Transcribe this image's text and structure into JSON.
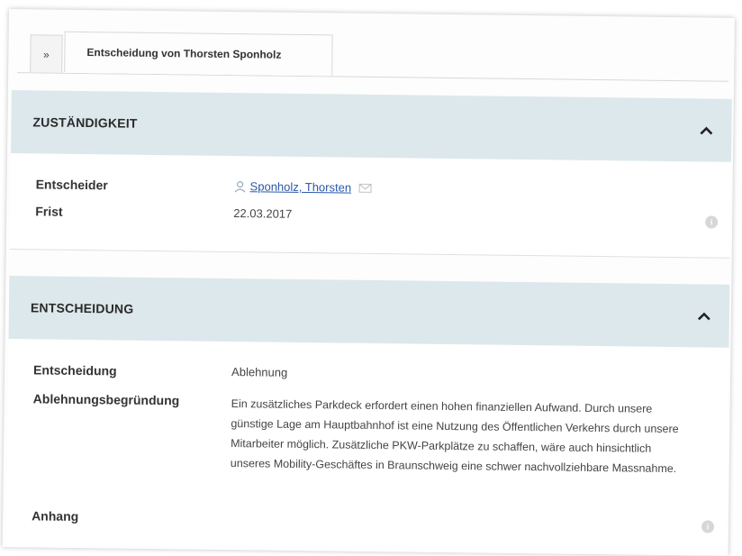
{
  "tabs": {
    "nav_symbol": "»",
    "active_label": "Entscheidung von Thorsten Sponholz"
  },
  "zustaendigkeit": {
    "header": "ZUSTÄNDIGKEIT",
    "entscheider_label": "Entscheider",
    "entscheider_value": "Sponholz, Thorsten",
    "frist_label": "Frist",
    "frist_value": "22.03.2017"
  },
  "entscheidung": {
    "header": "ENTSCHEIDUNG",
    "entscheidung_label": "Entscheidung",
    "entscheidung_value": "Ablehnung",
    "begruendung_label": "Ablehnungsbegründung",
    "begruendung_value": "Ein zusätzliches Parkdeck erfordert einen hohen finanziellen Aufwand. Durch unsere günstige Lage am Hauptbahnhof ist eine Nutzung des Öffentlichen Verkehrs durch unsere Mitarbeiter möglich. Zusätzliche PKW-Parkplätze zu schaffen, wäre auch hinsichtlich unseres Mobility-Geschäftes in Braunschweig eine schwer nachvollziehbare Massnahme.",
    "anhang_label": "Anhang"
  },
  "colors": {
    "section_header_bg": "#dde8ec",
    "link": "#2a5aa8"
  },
  "icons": [
    "user-icon",
    "mail-icon",
    "info-icon",
    "chevron-up-icon"
  ]
}
